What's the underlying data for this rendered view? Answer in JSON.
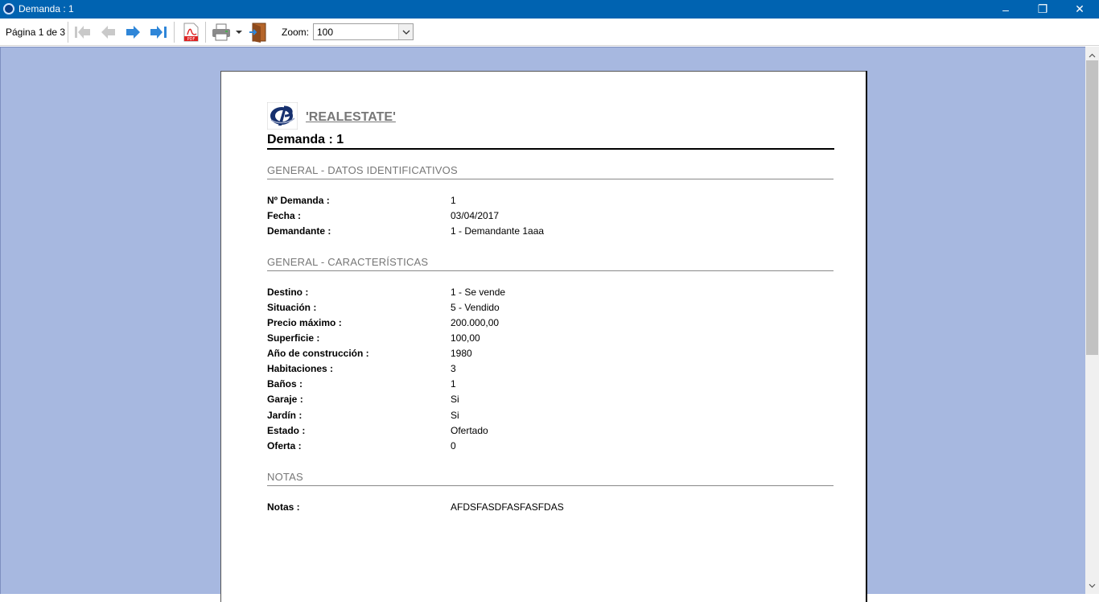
{
  "window": {
    "title": "Demanda : 1",
    "minimize": "–",
    "maximize": "❐",
    "close": "✕"
  },
  "toolbar": {
    "page_info": "Página 1 de 3",
    "zoom_label": "Zoom:",
    "zoom_value": "100",
    "icons": [
      "first-page-icon",
      "previous-page-icon",
      "next-page-icon",
      "last-page-icon",
      "pdf-export-icon",
      "printer-icon",
      "dropdown-arrow-icon",
      "exit-door-icon"
    ]
  },
  "report": {
    "brand": "'REALESTATE'",
    "title": "Demanda : 1",
    "sections": [
      {
        "title": "GENERAL - DATOS IDENTIFICATIVOS",
        "rows": [
          {
            "key": "Nº Demanda :",
            "value": "1"
          },
          {
            "key": "Fecha :",
            "value": "03/04/2017"
          },
          {
            "key": "Demandante :",
            "value": "1 - Demandante 1aaa"
          }
        ]
      },
      {
        "title": "GENERAL - CARACTERÍSTICAS",
        "rows": [
          {
            "key": "Destino :",
            "value": "1 - Se vende"
          },
          {
            "key": "Situación :",
            "value": "5 - Vendido"
          },
          {
            "key": "Precio máximo :",
            "value": "200.000,00"
          },
          {
            "key": "Superficie :",
            "value": "100,00"
          },
          {
            "key": "Año de construcción :",
            "value": "1980"
          },
          {
            "key": "Habitaciones :",
            "value": "3"
          },
          {
            "key": "Baños :",
            "value": "1"
          },
          {
            "key": "Garaje :",
            "value": "Si"
          },
          {
            "key": "Jardín :",
            "value": "Si"
          },
          {
            "key": "Estado :",
            "value": "Ofertado"
          },
          {
            "key": "Oferta :",
            "value": "0"
          }
        ]
      },
      {
        "title": "NOTAS",
        "rows": [
          {
            "key": "Notas :",
            "value": "AFDSFASDFASFASFDAS"
          }
        ]
      }
    ]
  },
  "colors": {
    "titlebar": "#0063b1",
    "viewer_background": "#a7b8e0",
    "section_title": "#777777"
  }
}
